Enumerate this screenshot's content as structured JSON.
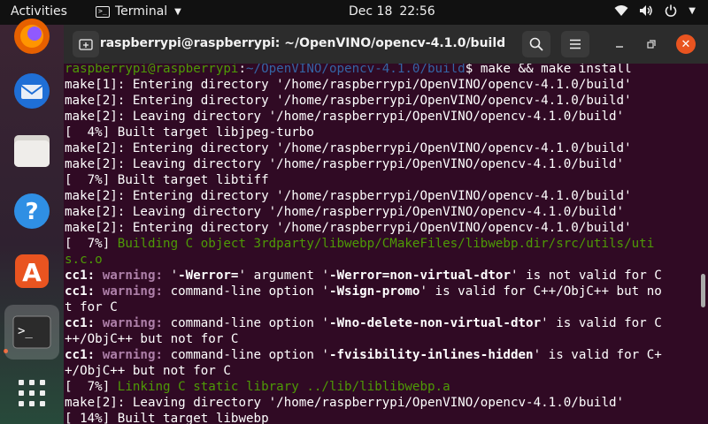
{
  "topbar": {
    "activities": "Activities",
    "app_name": "Terminal",
    "date": "Dec 18",
    "time": "22:56"
  },
  "window": {
    "title": "raspberrypi@raspberrypi: ~/OpenVINO/opencv-4.1.0/build"
  },
  "colors": {
    "accent": "#e95420",
    "terminal_bg": "#300a24",
    "green": "#4e9a06",
    "blue": "#3465a4",
    "warning": "#ad7fa8"
  },
  "dock": {
    "items": [
      "firefox-icon",
      "thunderbird-icon",
      "files-icon",
      "help-icon",
      "software-icon",
      "terminal-icon",
      "app-grid-icon"
    ]
  },
  "terminal": {
    "lines": [
      [
        {
          "t": "raspberrypi@raspberrypi",
          "c": "green"
        },
        {
          "t": ":"
        },
        {
          "t": "~/OpenVINO/opencv-4.1.0/build",
          "c": "blue"
        },
        {
          "t": "$ make && make install"
        }
      ],
      [
        {
          "t": "make[1]: Entering directory '/home/raspberrypi/OpenVINO/opencv-4.1.0/build'"
        }
      ],
      [
        {
          "t": "make[2]: Entering directory '/home/raspberrypi/OpenVINO/opencv-4.1.0/build'"
        }
      ],
      [
        {
          "t": "make[2]: Leaving directory '/home/raspberrypi/OpenVINO/opencv-4.1.0/build'"
        }
      ],
      [
        {
          "t": "[  4%] Built target libjpeg-turbo"
        }
      ],
      [
        {
          "t": "make[2]: Entering directory '/home/raspberrypi/OpenVINO/opencv-4.1.0/build'"
        }
      ],
      [
        {
          "t": "make[2]: Leaving directory '/home/raspberrypi/OpenVINO/opencv-4.1.0/build'"
        }
      ],
      [
        {
          "t": "[  7%] Built target libtiff"
        }
      ],
      [
        {
          "t": "make[2]: Entering directory '/home/raspberrypi/OpenVINO/opencv-4.1.0/build'"
        }
      ],
      [
        {
          "t": "make[2]: Leaving directory '/home/raspberrypi/OpenVINO/opencv-4.1.0/build'"
        }
      ],
      [
        {
          "t": "make[2]: Entering directory '/home/raspberrypi/OpenVINO/opencv-4.1.0/build'"
        }
      ],
      [
        {
          "t": "[  7%] "
        },
        {
          "t": "Building C object 3rdparty/libwebp/CMakeFiles/libwebp.dir/src/utils/uti",
          "c": "green"
        }
      ],
      [
        {
          "t": "s.c.o",
          "c": "green"
        }
      ],
      [
        {
          "t": "cc1: ",
          "c": "bold"
        },
        {
          "t": "warning: ",
          "c": "magenta"
        },
        {
          "t": "'"
        },
        {
          "t": "-Werror=",
          "c": "bold"
        },
        {
          "t": "' argument '"
        },
        {
          "t": "-Werror=non-virtual-dtor",
          "c": "bold"
        },
        {
          "t": "' is not valid for C"
        }
      ],
      [
        {
          "t": "cc1: ",
          "c": "bold"
        },
        {
          "t": "warning: ",
          "c": "magenta"
        },
        {
          "t": "command-line option '"
        },
        {
          "t": "-Wsign-promo",
          "c": "bold"
        },
        {
          "t": "' is valid for C++/ObjC++ but no"
        }
      ],
      [
        {
          "t": "t for C"
        }
      ],
      [
        {
          "t": "cc1: ",
          "c": "bold"
        },
        {
          "t": "warning: ",
          "c": "magenta"
        },
        {
          "t": "command-line option '"
        },
        {
          "t": "-Wno-delete-non-virtual-dtor",
          "c": "bold"
        },
        {
          "t": "' is valid for C"
        }
      ],
      [
        {
          "t": "++/ObjC++ but not for C"
        }
      ],
      [
        {
          "t": "cc1: ",
          "c": "bold"
        },
        {
          "t": "warning: ",
          "c": "magenta"
        },
        {
          "t": "command-line option '"
        },
        {
          "t": "-fvisibility-inlines-hidden",
          "c": "bold"
        },
        {
          "t": "' is valid for C+"
        }
      ],
      [
        {
          "t": "+/ObjC++ but not for C"
        }
      ],
      [
        {
          "t": "[  7%] "
        },
        {
          "t": "Linking C static library ../lib/liblibwebp.a",
          "c": "green"
        }
      ],
      [
        {
          "t": "make[2]: Leaving directory '/home/raspberrypi/OpenVINO/opencv-4.1.0/build'"
        }
      ],
      [
        {
          "t": "[ 14%] Built target libwebp"
        }
      ]
    ]
  }
}
